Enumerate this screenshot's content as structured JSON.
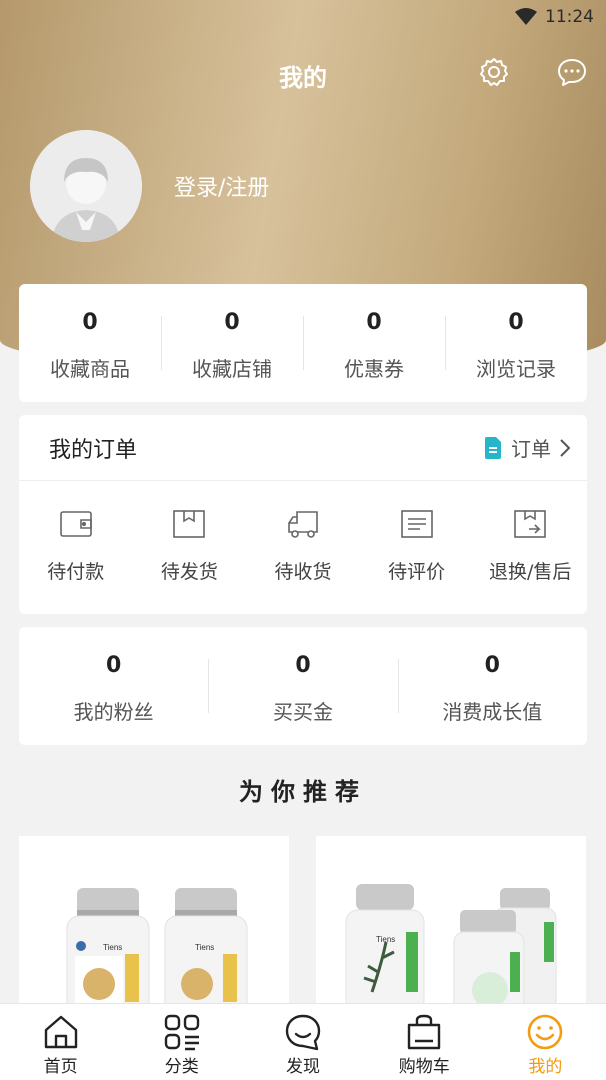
{
  "status_bar": {
    "time": "11:24"
  },
  "header": {
    "title": "我的"
  },
  "profile": {
    "login_text": "登录/注册"
  },
  "collection_stats": [
    {
      "value": "0",
      "label": "收藏商品"
    },
    {
      "value": "0",
      "label": "收藏店铺"
    },
    {
      "value": "0",
      "label": "优惠券"
    },
    {
      "value": "0",
      "label": "浏览记录"
    }
  ],
  "orders": {
    "title": "我的订单",
    "all_label": "订单",
    "items": [
      {
        "label": "待付款",
        "icon": "wallet-icon"
      },
      {
        "label": "待发货",
        "icon": "box-icon"
      },
      {
        "label": "待收货",
        "icon": "truck-icon"
      },
      {
        "label": "待评价",
        "icon": "review-icon"
      },
      {
        "label": "退换/售后",
        "icon": "return-icon"
      }
    ]
  },
  "social_stats": [
    {
      "value": "0",
      "label": "我的粉丝"
    },
    {
      "value": "0",
      "label": "买买金"
    },
    {
      "value": "0",
      "label": "消费成长值"
    }
  ],
  "recommend": {
    "title": "为你推荐",
    "products": [
      {
        "brand": "Tiens"
      },
      {
        "brand": "Tiens"
      }
    ]
  },
  "tabbar": {
    "items": [
      {
        "label": "首页",
        "icon": "home-icon"
      },
      {
        "label": "分类",
        "icon": "category-icon"
      },
      {
        "label": "发现",
        "icon": "discover-icon"
      },
      {
        "label": "购物车",
        "icon": "cart-icon"
      },
      {
        "label": "我的",
        "icon": "profile-smile-icon"
      }
    ],
    "active_index": 4
  },
  "colors": {
    "accent": "#f39c12",
    "header_gold": "#c7ad82",
    "order_icon": "#26b5c9"
  }
}
